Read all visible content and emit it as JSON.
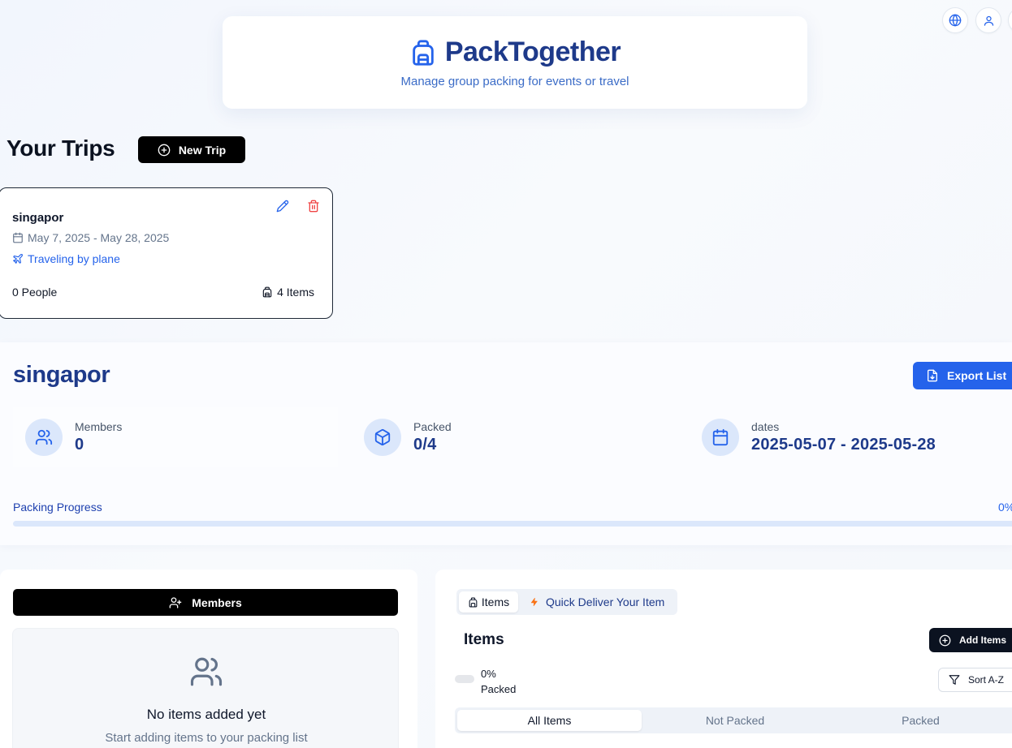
{
  "topbar": {
    "language_icon": "globe-icon",
    "profile_icon": "user-icon"
  },
  "header": {
    "logo_icon": "backpack-icon",
    "title": "PackTogether",
    "subtitle": "Manage group packing for events or travel"
  },
  "trips_section": {
    "heading": "Your Trips",
    "new_trip_label": "New Trip"
  },
  "trip_card": {
    "name": "singapor",
    "dates": "May 7, 2025 - May 28, 2025",
    "transport": "Traveling by plane",
    "people": "0 People",
    "items": "4 Items"
  },
  "overview": {
    "title": "singapor",
    "export_label": "Export List",
    "stats": [
      {
        "label": "Members",
        "value": "0",
        "icon": "users-icon"
      },
      {
        "label": "Packed",
        "value": "0/4",
        "icon": "box-icon"
      },
      {
        "label": "dates",
        "value": "2025-05-07 - 2025-05-28",
        "icon": "calendar-icon"
      }
    ],
    "progress_label": "Packing Progress",
    "progress_text": "0%",
    "progress_fraction": 0
  },
  "members_panel": {
    "button_label": "Members",
    "empty_title": "No items added yet",
    "empty_subtitle": "Start adding items to your packing list"
  },
  "items_panel": {
    "tabs": [
      {
        "label": "Items",
        "active": true
      },
      {
        "label": "Quick Deliver Your Item",
        "active": false
      }
    ],
    "title": "Items",
    "add_label": "Add Items",
    "packed_percent": "0%",
    "packed_word": "Packed",
    "sort_label": "Sort A-Z",
    "filters": [
      {
        "label": "All Items",
        "active": true
      },
      {
        "label": "Not Packed",
        "active": false
      },
      {
        "label": "Packed",
        "active": false
      }
    ]
  },
  "colors": {
    "brand": "#1e3a8a",
    "accent": "#2563eb",
    "danger": "#ef4444",
    "quick_icon": "#f97316"
  }
}
